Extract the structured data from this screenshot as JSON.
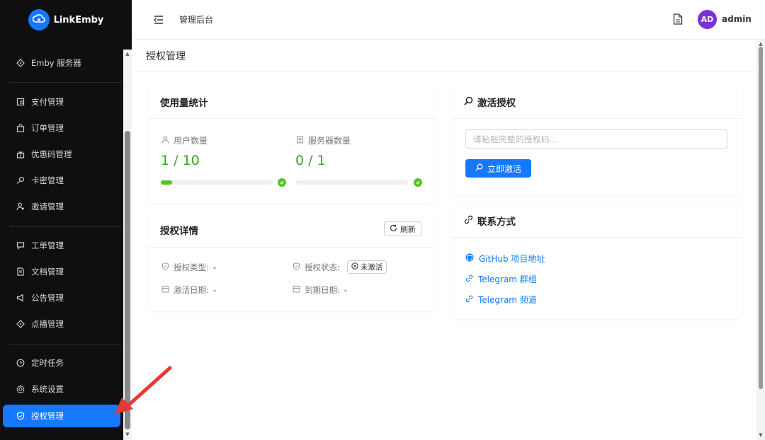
{
  "app": {
    "name": "LinkEmby"
  },
  "sidebar": {
    "items": [
      {
        "label": "Emby 服务器",
        "icon": "emby-icon"
      },
      {
        "label": "支付管理",
        "icon": "wallet-icon"
      },
      {
        "label": "订单管理",
        "icon": "bag-icon"
      },
      {
        "label": "优惠码管理",
        "icon": "gift-icon"
      },
      {
        "label": "卡密管理",
        "icon": "key-icon"
      },
      {
        "label": "邀请管理",
        "icon": "user-plus-icon"
      },
      {
        "label": "工单管理",
        "icon": "chat-icon"
      },
      {
        "label": "文档管理",
        "icon": "document-icon"
      },
      {
        "label": "公告管理",
        "icon": "megaphone-icon"
      },
      {
        "label": "点播管理",
        "icon": "play-icon"
      },
      {
        "label": "定时任务",
        "icon": "clock-icon"
      },
      {
        "label": "系统设置",
        "icon": "gear-icon"
      },
      {
        "label": "授权管理",
        "icon": "shield-icon",
        "active": true
      }
    ]
  },
  "header": {
    "breadcrumb": "管理后台",
    "avatar_initials": "AD",
    "username": "admin",
    "avatar_color": "#7b2fd6"
  },
  "page": {
    "title": "授权管理"
  },
  "usage": {
    "title": "使用量统计",
    "users": {
      "label": "用户数量",
      "value": "1 / 10",
      "progress": 0.1
    },
    "servers": {
      "label": "服务器数量",
      "value": "0 / 1",
      "progress": 0.0
    }
  },
  "details": {
    "title": "授权详情",
    "refresh_label": "刷新",
    "type_label": "授权类型:",
    "type_value": "-",
    "status_label": "授权状态:",
    "status_value": "未激活",
    "activated_label": "激活日期:",
    "activated_value": "-",
    "expire_label": "到期日期:",
    "expire_value": "-"
  },
  "activate": {
    "title": "激活授权",
    "placeholder": "请粘贴完整的授权码...",
    "button_label": "立即激活"
  },
  "contact": {
    "title": "联系方式",
    "links": [
      {
        "label": "GitHub 项目地址",
        "icon": "github-icon"
      },
      {
        "label": "Telegram 群组",
        "icon": "link-icon"
      },
      {
        "label": "Telegram 频道",
        "icon": "link-icon"
      }
    ]
  },
  "colors": {
    "accent": "#1677ff",
    "success": "#52c41a",
    "sidebar_bg": "#0f0f10",
    "annotation": "#e53935"
  }
}
